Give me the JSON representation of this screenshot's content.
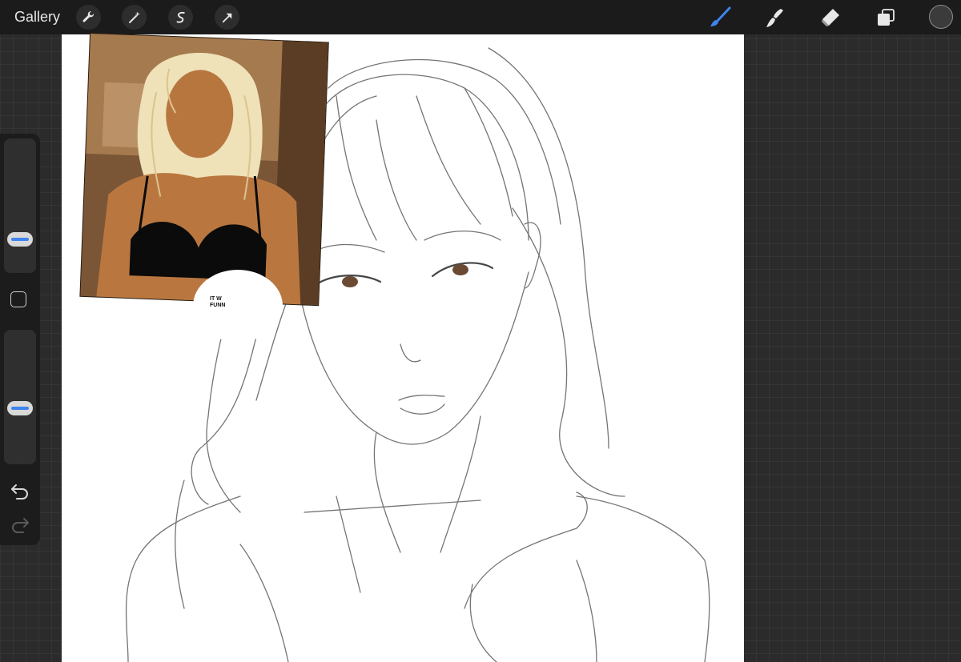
{
  "topbar": {
    "gallery_label": "Gallery",
    "left_tools": [
      "wrench-icon",
      "magic-wand-icon",
      "selection-icon",
      "transform-arrow-icon"
    ],
    "right_tools": [
      "brush-icon",
      "smudge-icon",
      "eraser-icon",
      "layers-icon"
    ],
    "active_tool": "brush",
    "accent_color": "#3f84f0",
    "current_color": "#3b3b3b"
  },
  "sidebar": {
    "brush_size_label": "",
    "opacity_label": "",
    "modify_button": "square-icon",
    "undo": "undo-icon",
    "redo": "redo-icon"
  },
  "canvas": {
    "reference_caption": "IT W\nFUNN"
  }
}
